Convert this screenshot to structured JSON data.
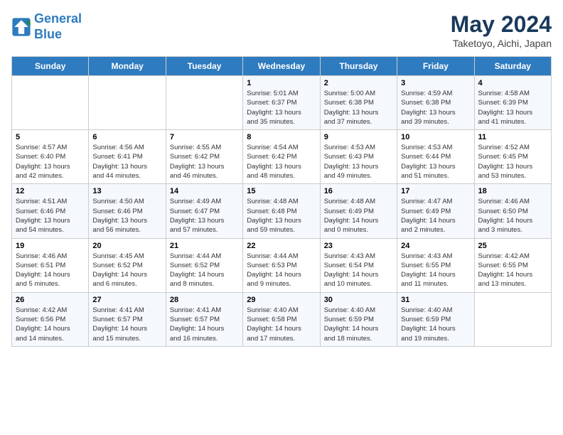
{
  "header": {
    "logo_line1": "General",
    "logo_line2": "Blue",
    "month_title": "May 2024",
    "subtitle": "Taketoyo, Aichi, Japan"
  },
  "days_of_week": [
    "Sunday",
    "Monday",
    "Tuesday",
    "Wednesday",
    "Thursday",
    "Friday",
    "Saturday"
  ],
  "weeks": [
    [
      {
        "day": "",
        "info": ""
      },
      {
        "day": "",
        "info": ""
      },
      {
        "day": "",
        "info": ""
      },
      {
        "day": "1",
        "info": "Sunrise: 5:01 AM\nSunset: 6:37 PM\nDaylight: 13 hours\nand 35 minutes."
      },
      {
        "day": "2",
        "info": "Sunrise: 5:00 AM\nSunset: 6:38 PM\nDaylight: 13 hours\nand 37 minutes."
      },
      {
        "day": "3",
        "info": "Sunrise: 4:59 AM\nSunset: 6:38 PM\nDaylight: 13 hours\nand 39 minutes."
      },
      {
        "day": "4",
        "info": "Sunrise: 4:58 AM\nSunset: 6:39 PM\nDaylight: 13 hours\nand 41 minutes."
      }
    ],
    [
      {
        "day": "5",
        "info": "Sunrise: 4:57 AM\nSunset: 6:40 PM\nDaylight: 13 hours\nand 42 minutes."
      },
      {
        "day": "6",
        "info": "Sunrise: 4:56 AM\nSunset: 6:41 PM\nDaylight: 13 hours\nand 44 minutes."
      },
      {
        "day": "7",
        "info": "Sunrise: 4:55 AM\nSunset: 6:42 PM\nDaylight: 13 hours\nand 46 minutes."
      },
      {
        "day": "8",
        "info": "Sunrise: 4:54 AM\nSunset: 6:42 PM\nDaylight: 13 hours\nand 48 minutes."
      },
      {
        "day": "9",
        "info": "Sunrise: 4:53 AM\nSunset: 6:43 PM\nDaylight: 13 hours\nand 49 minutes."
      },
      {
        "day": "10",
        "info": "Sunrise: 4:53 AM\nSunset: 6:44 PM\nDaylight: 13 hours\nand 51 minutes."
      },
      {
        "day": "11",
        "info": "Sunrise: 4:52 AM\nSunset: 6:45 PM\nDaylight: 13 hours\nand 53 minutes."
      }
    ],
    [
      {
        "day": "12",
        "info": "Sunrise: 4:51 AM\nSunset: 6:46 PM\nDaylight: 13 hours\nand 54 minutes."
      },
      {
        "day": "13",
        "info": "Sunrise: 4:50 AM\nSunset: 6:46 PM\nDaylight: 13 hours\nand 56 minutes."
      },
      {
        "day": "14",
        "info": "Sunrise: 4:49 AM\nSunset: 6:47 PM\nDaylight: 13 hours\nand 57 minutes."
      },
      {
        "day": "15",
        "info": "Sunrise: 4:48 AM\nSunset: 6:48 PM\nDaylight: 13 hours\nand 59 minutes."
      },
      {
        "day": "16",
        "info": "Sunrise: 4:48 AM\nSunset: 6:49 PM\nDaylight: 14 hours\nand 0 minutes."
      },
      {
        "day": "17",
        "info": "Sunrise: 4:47 AM\nSunset: 6:49 PM\nDaylight: 14 hours\nand 2 minutes."
      },
      {
        "day": "18",
        "info": "Sunrise: 4:46 AM\nSunset: 6:50 PM\nDaylight: 14 hours\nand 3 minutes."
      }
    ],
    [
      {
        "day": "19",
        "info": "Sunrise: 4:46 AM\nSunset: 6:51 PM\nDaylight: 14 hours\nand 5 minutes."
      },
      {
        "day": "20",
        "info": "Sunrise: 4:45 AM\nSunset: 6:52 PM\nDaylight: 14 hours\nand 6 minutes."
      },
      {
        "day": "21",
        "info": "Sunrise: 4:44 AM\nSunset: 6:52 PM\nDaylight: 14 hours\nand 8 minutes."
      },
      {
        "day": "22",
        "info": "Sunrise: 4:44 AM\nSunset: 6:53 PM\nDaylight: 14 hours\nand 9 minutes."
      },
      {
        "day": "23",
        "info": "Sunrise: 4:43 AM\nSunset: 6:54 PM\nDaylight: 14 hours\nand 10 minutes."
      },
      {
        "day": "24",
        "info": "Sunrise: 4:43 AM\nSunset: 6:55 PM\nDaylight: 14 hours\nand 11 minutes."
      },
      {
        "day": "25",
        "info": "Sunrise: 4:42 AM\nSunset: 6:55 PM\nDaylight: 14 hours\nand 13 minutes."
      }
    ],
    [
      {
        "day": "26",
        "info": "Sunrise: 4:42 AM\nSunset: 6:56 PM\nDaylight: 14 hours\nand 14 minutes."
      },
      {
        "day": "27",
        "info": "Sunrise: 4:41 AM\nSunset: 6:57 PM\nDaylight: 14 hours\nand 15 minutes."
      },
      {
        "day": "28",
        "info": "Sunrise: 4:41 AM\nSunset: 6:57 PM\nDaylight: 14 hours\nand 16 minutes."
      },
      {
        "day": "29",
        "info": "Sunrise: 4:40 AM\nSunset: 6:58 PM\nDaylight: 14 hours\nand 17 minutes."
      },
      {
        "day": "30",
        "info": "Sunrise: 4:40 AM\nSunset: 6:59 PM\nDaylight: 14 hours\nand 18 minutes."
      },
      {
        "day": "31",
        "info": "Sunrise: 4:40 AM\nSunset: 6:59 PM\nDaylight: 14 hours\nand 19 minutes."
      },
      {
        "day": "",
        "info": ""
      }
    ]
  ]
}
